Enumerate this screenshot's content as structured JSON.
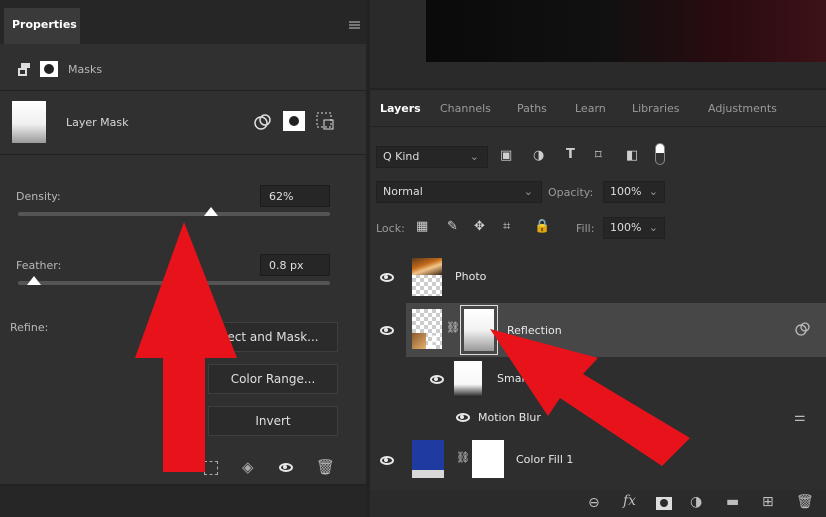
{
  "properties": {
    "title": "Properties",
    "header_label": "Masks",
    "mask_label": "Layer Mask",
    "density_label": "Density:",
    "density_value": "62%",
    "density_level": 0.62,
    "feather_label": "Feather:",
    "feather_value": "0.8 px",
    "feather_level": 0.05,
    "refine_label": "Refine:",
    "buttons": {
      "select_and_mask": "ect and Mask...",
      "color_range": "Color Range...",
      "invert": "Invert"
    }
  },
  "layers_panel": {
    "tabs": [
      "Layers",
      "Channels",
      "Paths",
      "Learn",
      "Libraries",
      "Adjustments"
    ],
    "filter_kind": "Q Kind",
    "blend_mode": "Normal",
    "opacity_label": "Opacity:",
    "opacity_value": "100%",
    "lock_label": "Lock:",
    "fill_label": "Fill:",
    "fill_value": "100%",
    "layers": [
      {
        "name": "Photo"
      },
      {
        "name": "Reflection"
      },
      {
        "name": "Smart F"
      },
      {
        "name": "Motion Blur"
      },
      {
        "name": "Color Fill 1"
      }
    ]
  },
  "colors": {
    "arrow": "#e8121b",
    "color_fill": "#1f3aa0"
  }
}
